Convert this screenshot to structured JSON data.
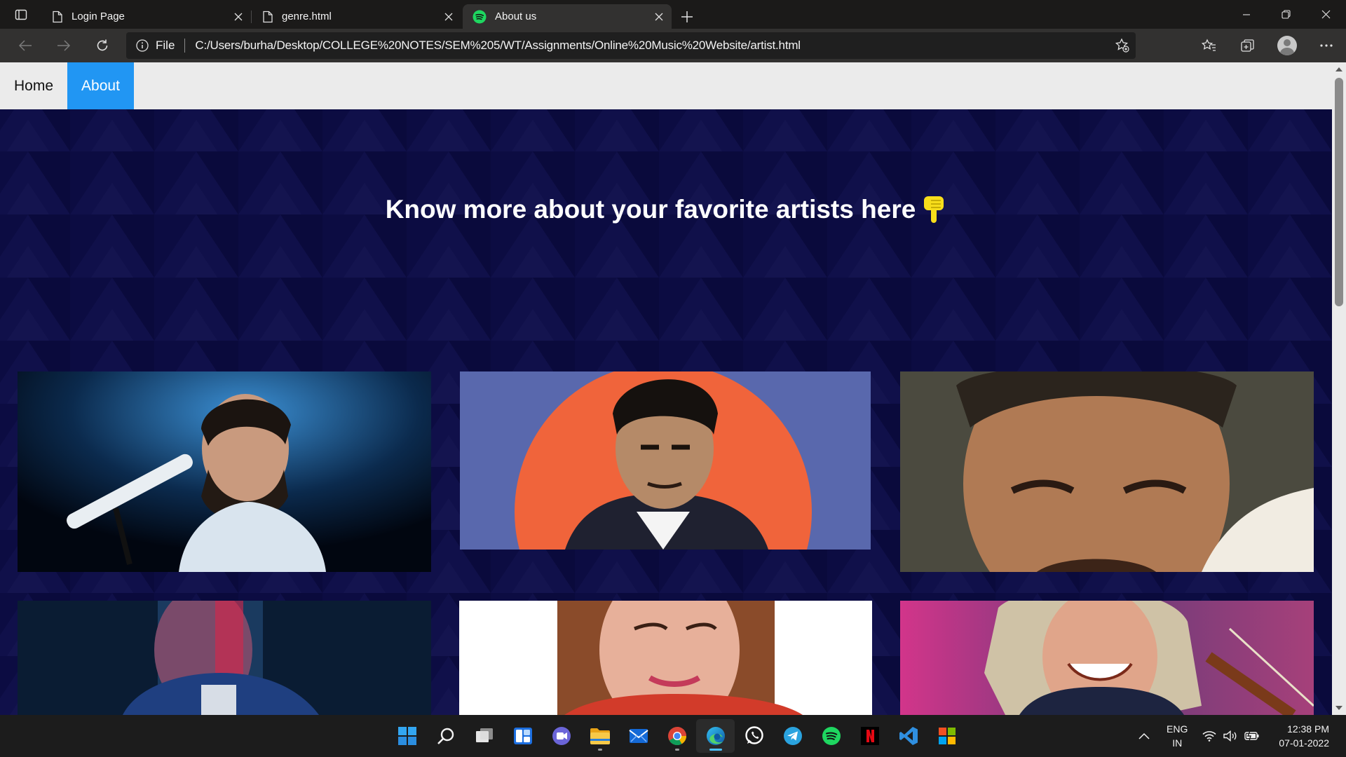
{
  "browser": {
    "tabs": [
      {
        "title": "Login Page",
        "icon": "page-icon",
        "active": false
      },
      {
        "title": "genre.html",
        "icon": "page-icon",
        "active": false
      },
      {
        "title": "About us",
        "icon": "spotify-icon",
        "active": true
      }
    ],
    "address": {
      "scheme_label": "File",
      "url": "C:/Users/burha/Desktop/COLLEGE%20NOTES/SEM%205/WT/Assignments/Online%20Music%20Website/artist.html"
    }
  },
  "page": {
    "nav": {
      "home": "Home",
      "about": "About"
    },
    "headline": "Know more about your favorite artists here",
    "headline_emoji": "👇",
    "colors": {
      "nav_active": "#2196f3",
      "hero_bg": "#070736"
    },
    "artists": [
      {
        "label": "artist-photo-1",
        "bg": "#020a18"
      },
      {
        "label": "artist-photo-2",
        "bg": "#5968ad"
      },
      {
        "label": "artist-photo-3",
        "bg": "#4b4a3f"
      },
      {
        "label": "artist-photo-4",
        "bg": "#0a1c33"
      },
      {
        "label": "artist-photo-5",
        "bg": "#ffffff"
      },
      {
        "label": "artist-photo-6",
        "bg": "#6a3b7a"
      }
    ]
  },
  "taskbar": {
    "apps": [
      "windows-start-icon",
      "search-icon",
      "task-view-icon",
      "widgets-icon",
      "teams-chat-icon",
      "file-explorer-icon",
      "mail-icon",
      "chrome-icon",
      "edge-icon",
      "whatsapp-icon",
      "telegram-icon",
      "spotify-icon",
      "netflix-icon",
      "vscode-icon",
      "office-icon"
    ],
    "lang_line1": "ENG",
    "lang_line2": "IN",
    "time": "12:38 PM",
    "date": "07-01-2022"
  }
}
